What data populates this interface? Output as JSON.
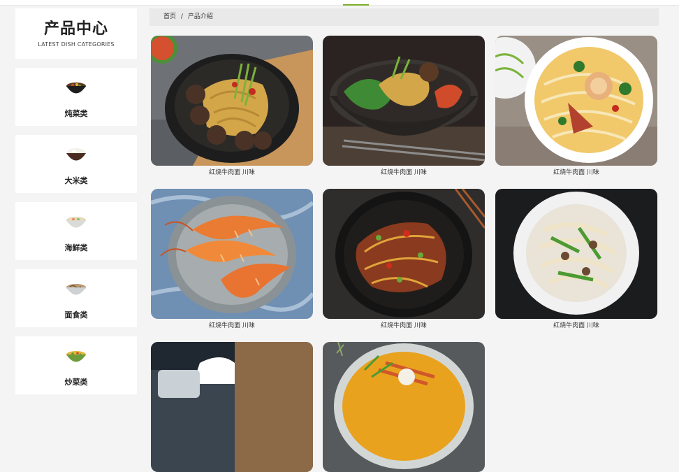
{
  "sidebar": {
    "title": "产品中心",
    "subtitle": "LATEST DISH CATEGORIES",
    "categories": [
      {
        "label": "炖菜类",
        "icon": "stew-bowl-icon"
      },
      {
        "label": "大米类",
        "icon": "rice-bowl-icon"
      },
      {
        "label": "海鲜类",
        "icon": "seafood-bowl-icon"
      },
      {
        "label": "面食类",
        "icon": "noodle-bowl-icon"
      },
      {
        "label": "炒菜类",
        "icon": "stirfry-bowl-icon"
      }
    ]
  },
  "breadcrumb": {
    "home": "首页",
    "separator": "/",
    "current": "产品介绍"
  },
  "products": [
    {
      "caption": "红烧牛肉面 川味",
      "image": "noodles-with-meatballs"
    },
    {
      "caption": "红烧牛肉面 川味",
      "image": "dark-bowl-greens-noodles"
    },
    {
      "caption": "红烧牛肉面 川味",
      "image": "rice-noodle-soup"
    },
    {
      "caption": "红烧牛肉面 川味",
      "image": "grilled-prawns"
    },
    {
      "caption": "红烧牛肉面 川味",
      "image": "spicy-stir-fry"
    },
    {
      "caption": "红烧牛肉面 川味",
      "image": "fried-noodles-peppers"
    },
    {
      "caption": "",
      "image": "restaurant-table"
    },
    {
      "caption": "",
      "image": "curry-bowl"
    }
  ],
  "colors": {
    "accent": "#7cae27",
    "background": "#f4f4f4"
  }
}
